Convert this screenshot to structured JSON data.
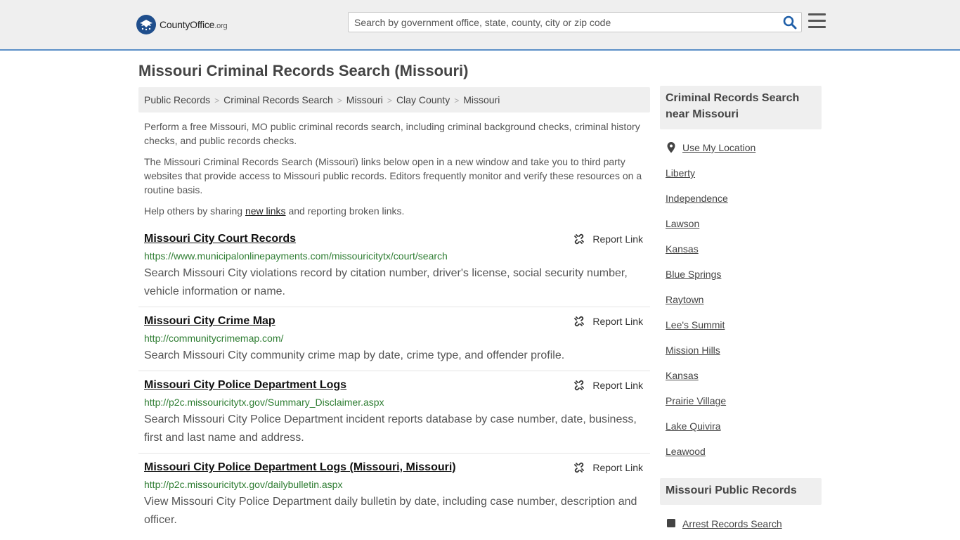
{
  "header": {
    "logo_text": "CountyOffice",
    "logo_suffix": ".org",
    "search_placeholder": "Search by government office, state, county, city or zip code"
  },
  "page_title": "Missouri Criminal Records Search (Missouri)",
  "breadcrumbs": [
    "Public Records",
    "Criminal Records Search",
    "Missouri",
    "Clay County",
    "Missouri"
  ],
  "intro": {
    "p1": "Perform a free Missouri, MO public criminal records search, including criminal background checks, criminal history checks, and public records checks.",
    "p2": "The Missouri Criminal Records Search (Missouri) links below open in a new window and take you to third party websites that provide access to Missouri public records. Editors frequently monitor and verify these resources on a routine basis.",
    "p3_before": "Help others by sharing ",
    "p3_link": "new links",
    "p3_after": " and reporting broken links."
  },
  "report_label": "Report Link",
  "results": [
    {
      "title": "Missouri City Court Records",
      "url": "https://www.municipalonlinepayments.com/missouricitytx/court/search",
      "desc": "Search Missouri City violations record by citation number, driver's license, social security number, vehicle information or name."
    },
    {
      "title": "Missouri City Crime Map",
      "url": "http://communitycrimemap.com/",
      "desc": "Search Missouri City community crime map by date, crime type, and offender profile."
    },
    {
      "title": "Missouri City Police Department Logs",
      "url": "http://p2c.missouricitytx.gov/Summary_Disclaimer.aspx",
      "desc": "Search Missouri City Police Department incident reports database by case number, date, business, first and last name and address."
    },
    {
      "title": "Missouri City Police Department Logs (Missouri, Missouri)",
      "url": "http://p2c.missouricitytx.gov/dailybulletin.aspx",
      "desc": "View Missouri City Police Department daily bulletin by date, including case number, description and officer."
    }
  ],
  "sidebar": {
    "nearby_title": "Criminal Records Search near Missouri",
    "use_location": "Use My Location",
    "nearby": [
      "Liberty",
      "Independence",
      "Lawson",
      "Kansas",
      "Blue Springs",
      "Raytown",
      "Lee's Summit",
      "Mission Hills",
      "Kansas",
      "Prairie Village",
      "Lake Quivira",
      "Leawood"
    ],
    "public_title": "Missouri Public Records",
    "public_links": [
      "Arrest Records Search"
    ]
  }
}
